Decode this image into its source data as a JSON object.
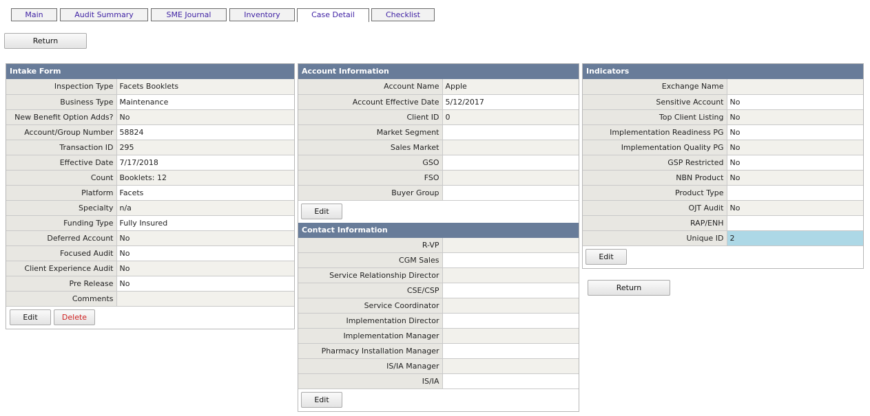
{
  "tabs": [
    {
      "label": "Main",
      "active": false
    },
    {
      "label": "Audit Summary",
      "active": false
    },
    {
      "label": "SME Journal",
      "active": false
    },
    {
      "label": "Inventory",
      "active": false
    },
    {
      "label": "Case Detail",
      "active": true
    },
    {
      "label": "Checklist",
      "active": false
    }
  ],
  "buttons": {
    "return": "Return",
    "edit": "Edit",
    "delete": "Delete"
  },
  "intake": {
    "title": "Intake Form",
    "rows": [
      {
        "label": "Inspection Type",
        "value": "Facets Booklets"
      },
      {
        "label": "Business Type",
        "value": "Maintenance"
      },
      {
        "label": "New Benefit Option Adds?",
        "value": "No"
      },
      {
        "label": "Account/Group Number",
        "value": "58824"
      },
      {
        "label": "Transaction ID",
        "value": "295"
      },
      {
        "label": "Effective Date",
        "value": "7/17/2018"
      },
      {
        "label": "Count",
        "value": "Booklets: 12"
      },
      {
        "label": "Platform",
        "value": "Facets"
      },
      {
        "label": "Specialty",
        "value": "n/a"
      },
      {
        "label": "Funding Type",
        "value": "Fully Insured"
      },
      {
        "label": "Deferred Account",
        "value": "No"
      },
      {
        "label": "Focused Audit",
        "value": "No"
      },
      {
        "label": "Client Experience Audit",
        "value": "No"
      },
      {
        "label": "Pre Release",
        "value": "No"
      },
      {
        "label": "Comments",
        "value": ""
      }
    ]
  },
  "account": {
    "title": "Account Information",
    "rows": [
      {
        "label": "Account Name",
        "value": "Apple"
      },
      {
        "label": "Account Effective Date",
        "value": "5/12/2017"
      },
      {
        "label": "Client ID",
        "value": "0"
      },
      {
        "label": "Market Segment",
        "value": ""
      },
      {
        "label": "Sales Market",
        "value": ""
      },
      {
        "label": "GSO",
        "value": ""
      },
      {
        "label": "FSO",
        "value": ""
      },
      {
        "label": "Buyer Group",
        "value": ""
      }
    ]
  },
  "contact": {
    "title": "Contact Information",
    "rows": [
      {
        "label": "R-VP",
        "value": ""
      },
      {
        "label": "CGM Sales",
        "value": ""
      },
      {
        "label": "Service Relationship Director",
        "value": ""
      },
      {
        "label": "CSE/CSP",
        "value": ""
      },
      {
        "label": "Service Coordinator",
        "value": ""
      },
      {
        "label": "Implementation Director",
        "value": ""
      },
      {
        "label": "Implementation Manager",
        "value": ""
      },
      {
        "label": "Pharmacy Installation Manager",
        "value": ""
      },
      {
        "label": "IS/IA Manager",
        "value": ""
      },
      {
        "label": "IS/IA",
        "value": ""
      }
    ]
  },
  "indicators": {
    "title": "Indicators",
    "rows": [
      {
        "label": "Exchange Name",
        "value": ""
      },
      {
        "label": "Sensitive Account",
        "value": "No"
      },
      {
        "label": "Top Client Listing",
        "value": "No"
      },
      {
        "label": "Implementation Readiness PG",
        "value": "No"
      },
      {
        "label": "Implementation Quality PG",
        "value": "No"
      },
      {
        "label": "GSP Restricted",
        "value": "No"
      },
      {
        "label": "NBN Product",
        "value": "No"
      },
      {
        "label": "Product Type",
        "value": ""
      },
      {
        "label": "OJT Audit",
        "value": "No"
      },
      {
        "label": "RAP/ENH",
        "value": ""
      },
      {
        "label": "Unique ID",
        "value": "2"
      }
    ]
  },
  "colors": {
    "header": "#687c99",
    "tab_text": "#3d1fa3",
    "highlight": "#add8e6",
    "delete_text": "#d02020"
  }
}
